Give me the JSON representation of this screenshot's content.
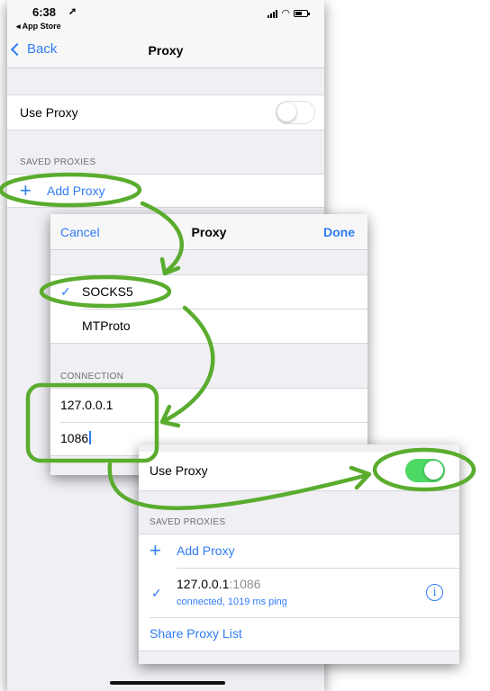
{
  "status_bar": {
    "time": "6:38",
    "back_app": "◂ App Store"
  },
  "screen1": {
    "nav": {
      "back_label": "Back",
      "title": "Proxy"
    },
    "use_proxy_label": "Use Proxy",
    "use_proxy_on": false,
    "saved_header": "SAVED PROXIES",
    "add_proxy_label": "Add Proxy"
  },
  "screen2": {
    "cancel_label": "Cancel",
    "title": "Proxy",
    "done_label": "Done",
    "types": [
      {
        "label": "SOCKS5",
        "selected": true
      },
      {
        "label": "MTProto",
        "selected": false
      }
    ],
    "connection_header": "CONNECTION",
    "server_value": "127.0.0.1",
    "port_value": "1086"
  },
  "screen3": {
    "use_proxy_label": "Use Proxy",
    "use_proxy_on": true,
    "saved_header": "SAVED PROXIES",
    "add_proxy_label": "Add Proxy",
    "proxy_host": "127.0.0.1",
    "proxy_port": ":1086",
    "proxy_status": "connected, 1019 ms ping",
    "share_label": "Share Proxy List"
  },
  "colors": {
    "accent": "#2f7cf6",
    "annotation": "#5aac2e",
    "toggle_on": "#4cd964"
  },
  "icons": [
    "location-arrow-icon",
    "signal-icon",
    "wifi-icon",
    "battery-icon",
    "chevron-left-icon",
    "plus-icon",
    "checkmark-icon",
    "info-icon"
  ]
}
